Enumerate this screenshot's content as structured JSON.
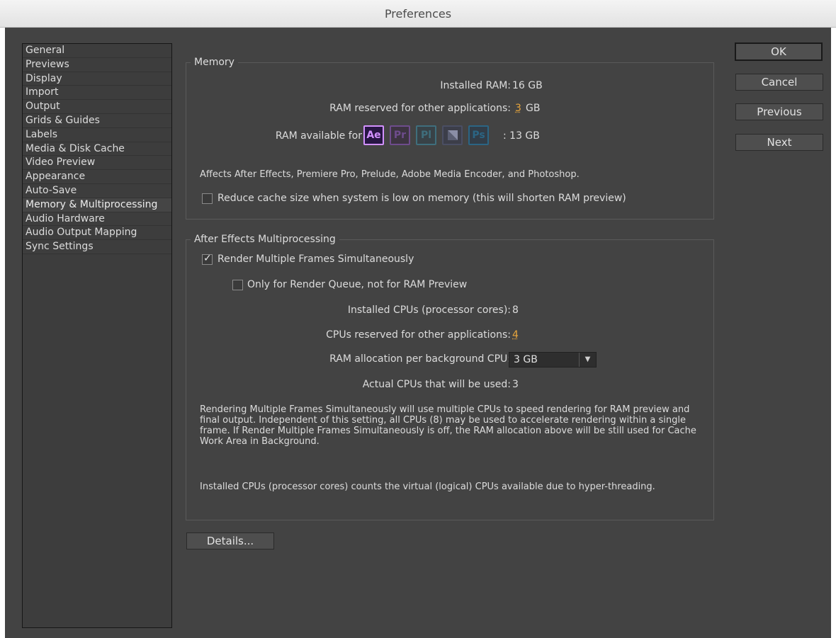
{
  "window": {
    "title": "Preferences"
  },
  "sidebar": {
    "items": [
      {
        "label": "General"
      },
      {
        "label": "Previews"
      },
      {
        "label": "Display"
      },
      {
        "label": "Import"
      },
      {
        "label": "Output"
      },
      {
        "label": "Grids & Guides"
      },
      {
        "label": "Labels"
      },
      {
        "label": "Media & Disk Cache"
      },
      {
        "label": "Video Preview"
      },
      {
        "label": "Appearance"
      },
      {
        "label": "Auto-Save"
      },
      {
        "label": "Memory & Multiprocessing",
        "selected": true
      },
      {
        "label": "Audio Hardware"
      },
      {
        "label": "Audio Output Mapping"
      },
      {
        "label": "Sync Settings"
      }
    ]
  },
  "memory": {
    "title": "Memory",
    "installed_label": "Installed RAM:",
    "installed_value": "16 GB",
    "reserved_label": "RAM reserved for other applications:",
    "reserved_value": "3",
    "reserved_unit": "GB",
    "available_label": "RAM available for",
    "available_value": ": 13 GB",
    "apps": [
      {
        "label": "Ae",
        "color": "#d291ff",
        "bg": "#281644",
        "active": true
      },
      {
        "label": "Pr",
        "color": "#6e4c8c",
        "bg": "#3d3441"
      },
      {
        "label": "Pl",
        "color": "#3f6e7c",
        "bg": "#384247"
      },
      {
        "label": "",
        "color": "#4a4e63",
        "bg": "#3c3e49"
      },
      {
        "label": "Ps",
        "color": "#2b6584",
        "bg": "#323d48"
      }
    ],
    "affects_text": "Affects After Effects, Premiere Pro, Prelude, Adobe Media Encoder, and Photoshop.",
    "reduce_cache_label": "Reduce cache size when system is low on memory (this will shorten RAM preview)"
  },
  "multiprocessing": {
    "title": "After Effects Multiprocessing",
    "render_multiple_label": "Render Multiple Frames Simultaneously",
    "render_queue_only_label": "Only for Render Queue, not for RAM Preview",
    "installed_cpus_label": "Installed CPUs (processor cores):",
    "installed_cpus_value": "8",
    "reserved_cpus_label": "CPUs reserved for other applications:",
    "reserved_cpus_value": "4",
    "ram_alloc_label": "RAM allocation per background CPU:",
    "ram_alloc_value": "3 GB",
    "actual_cpus_label": "Actual CPUs that will be used:",
    "actual_cpus_value": "3",
    "info_text_1": "Rendering Multiple Frames Simultaneously will use multiple CPUs to speed rendering for RAM preview and final output. Independent of this setting, all CPUs (8) may be used to accelerate rendering within a single frame. If Render Multiple Frames Simultaneously is off, the RAM allocation above will be still used for Cache Work Area in Background.",
    "info_text_2": "Installed CPUs (processor cores) counts the virtual (logical) CPUs available due to hyper-threading."
  },
  "buttons": {
    "ok": "OK",
    "cancel": "Cancel",
    "previous": "Previous",
    "next": "Next",
    "details": "Details..."
  }
}
